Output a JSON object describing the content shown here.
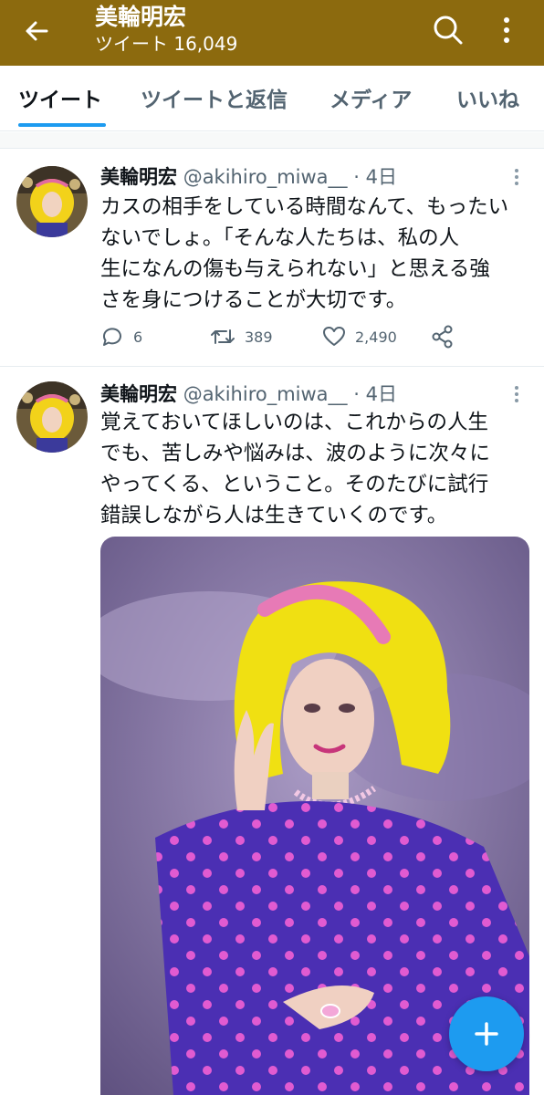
{
  "header": {
    "title": "美輪明宏",
    "subtitle": "ツイート 16,049",
    "back_icon": "arrow-left-icon",
    "search_icon": "search-icon",
    "more_icon": "more-vertical-icon",
    "bar_color": "#8c6a0e"
  },
  "tabs": [
    {
      "label": "ツイート",
      "active": true
    },
    {
      "label": "ツイートと返信",
      "active": false
    },
    {
      "label": "メディア",
      "active": false
    },
    {
      "label": "いいね",
      "active": false
    }
  ],
  "tweets": [
    {
      "name": "美輪明宏",
      "handle": "@akihiro_miwa__",
      "separator": "·",
      "time": "4日",
      "lines": [
        "カスの相手をしている時間なんて、もったい",
        "ないでしょ。「そんな人たちは、私の人",
        "生になんの傷も与えられない」と思える強",
        "さを身につけることが大切です。"
      ],
      "replies": "6",
      "retweets": "389",
      "likes": "2,490"
    },
    {
      "name": "美輪明宏",
      "handle": "@akihiro_miwa__",
      "separator": "·",
      "time": "4日",
      "lines": [
        "覚えておいてほしいのは、これからの人生",
        "でも、苦しみや悩みは、波のように次々に",
        "やってくる、ということ。そのたびに試行",
        "錯誤しながら人は生きていくのです。"
      ]
    }
  ],
  "fab": {
    "icon": "plus-icon",
    "color": "#1d9bf0"
  },
  "accent": "#1d9bf0"
}
